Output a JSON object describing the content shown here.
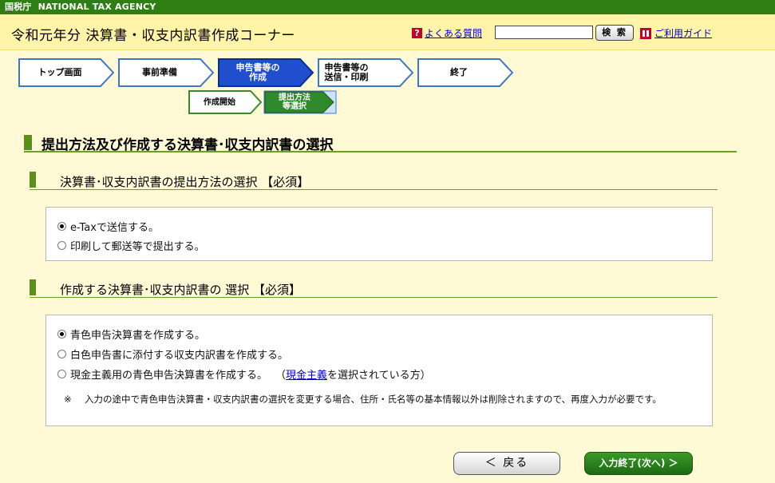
{
  "agency": {
    "jp": "国税庁",
    "en": "NATIONAL TAX AGENCY"
  },
  "header": {
    "title": "令和元年分 決算書・収支内訳書作成コーナー",
    "faq_label": "よくある質問",
    "search_placeholder": "",
    "search_button": "検 索",
    "guide_label": "ご利用ガイド"
  },
  "steps": [
    {
      "label": "トップ画面",
      "state": "default"
    },
    {
      "label": "事前準備",
      "state": "default"
    },
    {
      "label": "申告書等の\n作成",
      "state": "current"
    },
    {
      "label": "申告書等の\n送信・印刷",
      "state": "default"
    },
    {
      "label": "終了",
      "state": "default"
    }
  ],
  "substeps": [
    {
      "label": "作成開始",
      "state": "default"
    },
    {
      "label": "提出方法\n等選択",
      "state": "current"
    }
  ],
  "main_heading": "提出方法及び作成する決算書･収支内訳書の選択",
  "section1": {
    "heading": "決算書･収支内訳書の提出方法の選択 【必須】",
    "options": [
      {
        "label": "e-Taxで送信する。",
        "selected": true
      },
      {
        "label": "印刷して郵送等で提出する。",
        "selected": false
      }
    ]
  },
  "section2": {
    "heading": "作成する決算書･収支内訳書の 選択 【必須】",
    "options": [
      {
        "label": "青色申告決算書を作成する。",
        "selected": true
      },
      {
        "label": "白色申告書に添付する収支内訳書を作成する。",
        "selected": false
      },
      {
        "label": "現金主義用の青色申告決算書を作成する。",
        "selected": false,
        "suffix_open": "（",
        "suffix_link": "現金主義",
        "suffix_close": "を選択されている方）"
      }
    ],
    "note_mark": "※",
    "note": "入力の途中で青色申告決算書・収支内訳書の選択を変更する場合、住所・氏名等の基本情報以外は削除されますので、再度入力が必要です。"
  },
  "buttons": {
    "back": "＜ 戻る",
    "next": "入力終了(次へ) ＞"
  },
  "colors": {
    "agency_bar": "#2d7f14",
    "header_bg": "#fff4a8",
    "page_bg": "#fff9d6",
    "current_step": "#1f4fcf",
    "current_substep": "#2e8a2a",
    "accent_green": "#5a8f1c"
  }
}
